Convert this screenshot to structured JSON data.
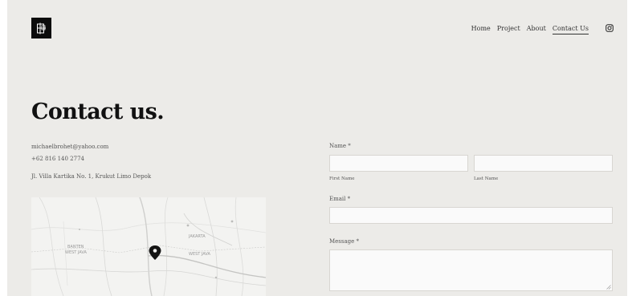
{
  "nav": {
    "items": [
      "Home",
      "Project",
      "About",
      "Contact Us"
    ],
    "instagram_icon": "instagram-icon"
  },
  "page": {
    "title": "Contact us."
  },
  "contact": {
    "email": "michaelbrohet@yahoo.com",
    "phone": "+62 816 140 2774",
    "address": "Jl. Villa Kartika No. 1, Krukut Limo Depok"
  },
  "map": {
    "labels": [
      "BANTEN",
      "WEST JAVA",
      "JAKARTA",
      "WEST JAVA"
    ],
    "marker_icon": "map-pin-icon"
  },
  "form": {
    "name_label": "Name *",
    "first_name_label": "First Name",
    "last_name_label": "Last Name",
    "email_label": "Email *",
    "message_label": "Message *"
  },
  "colors": {
    "page_background": "#ecebe8",
    "accent": "#111111",
    "field_background": "#fafafa"
  }
}
